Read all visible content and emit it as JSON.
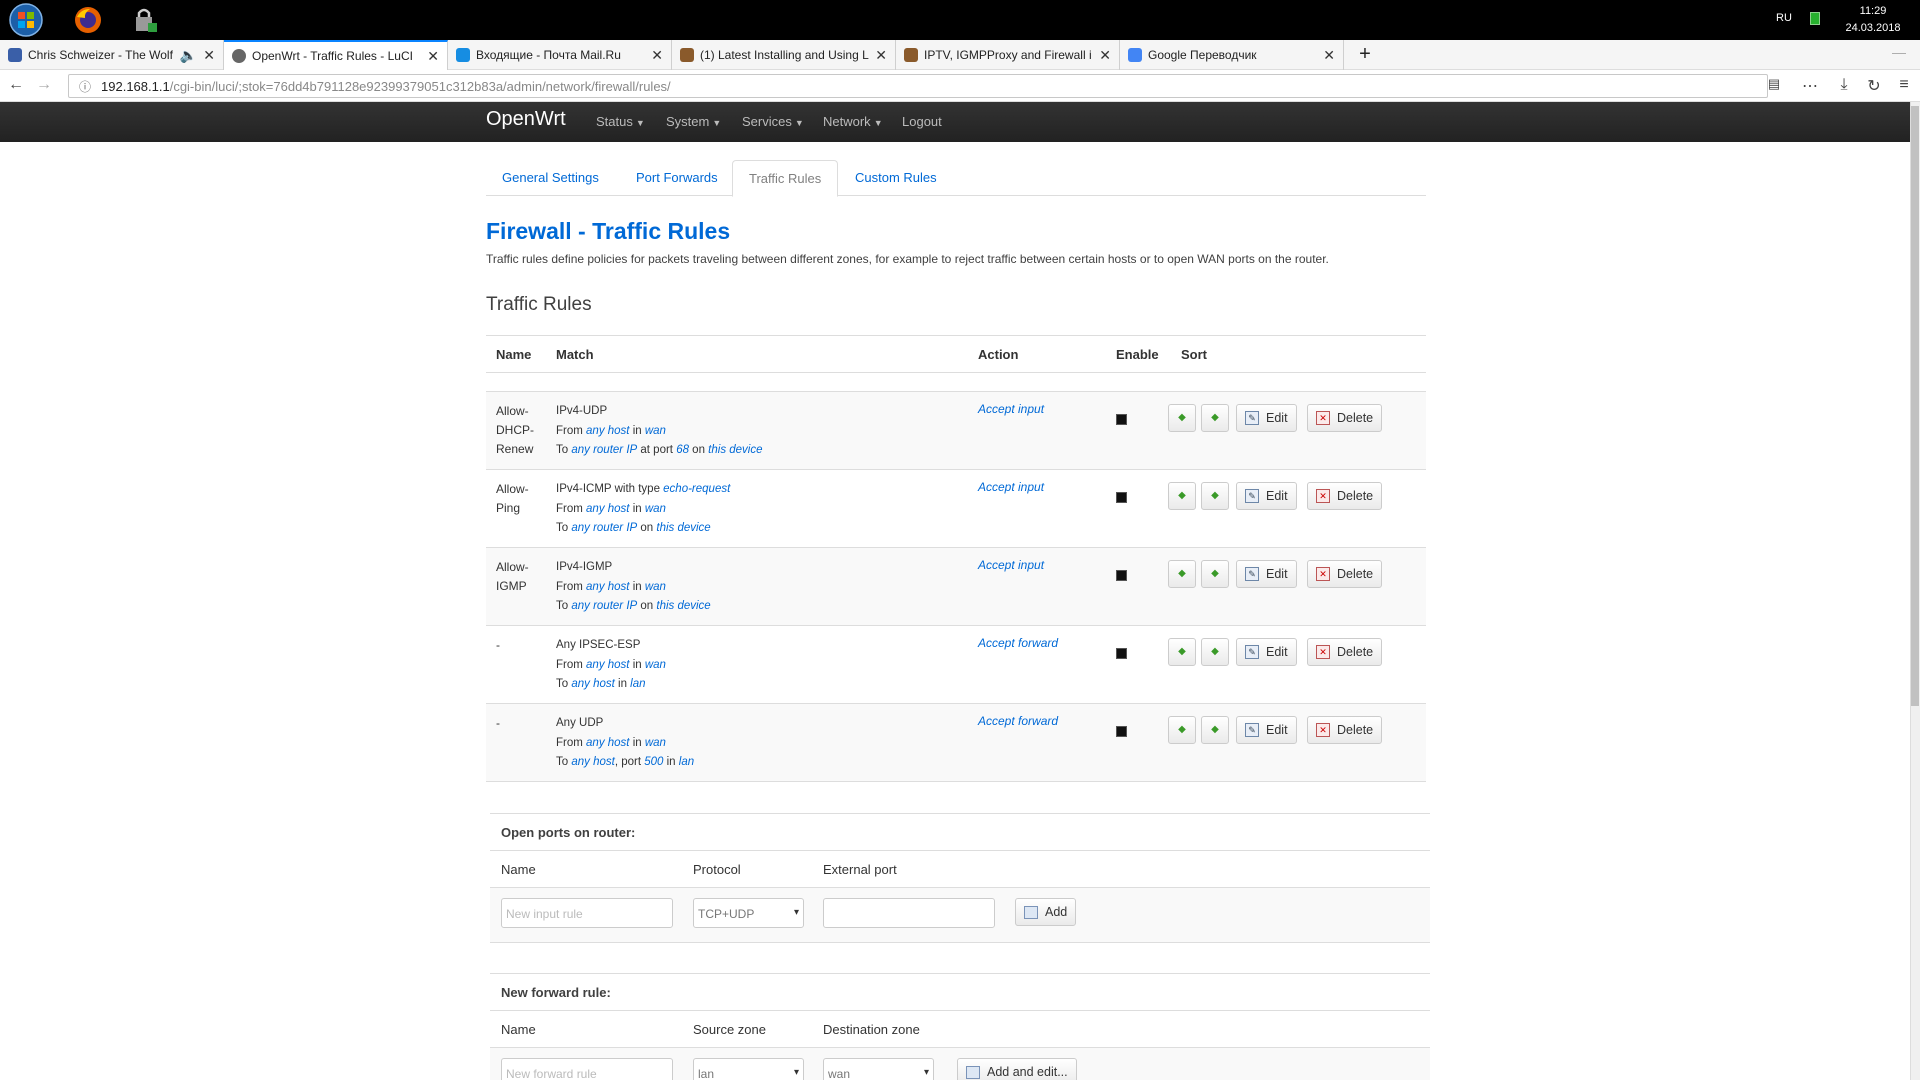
{
  "taskbar": {
    "lang": "RU",
    "time": "11:29",
    "date": "24.03.2018"
  },
  "browser": {
    "tabs": [
      {
        "title": "Chris Schweizer - The Wolf",
        "color": "#3a5fa8"
      },
      {
        "title": "OpenWrt - Traffic Rules - LuCI",
        "color": "#666666"
      },
      {
        "title": "Входящие - Почта Mail.Ru",
        "color": "#168de2"
      },
      {
        "title": "(1) Latest Installing and Using L",
        "color": "#8a5a2b"
      },
      {
        "title": "IPTV, IGMPProxy and Firewall i",
        "color": "#8a5a2b"
      },
      {
        "title": "Google Переводчик",
        "color": "#4285f4"
      }
    ],
    "url_host": "192.168.1.1",
    "url_path": "/cgi-bin/luci/;stok=76dd4b791128e92399379051c312b83a/admin/network/firewall/rules/"
  },
  "header": {
    "brand": "OpenWrt",
    "menu": [
      "Status",
      "System",
      "Services",
      "Network"
    ],
    "logout": "Logout"
  },
  "subtabs": [
    "General Settings",
    "Port Forwards",
    "Traffic Rules",
    "Custom Rules"
  ],
  "page": {
    "title_prefix": "Firewall - ",
    "title_main": "Traffic Rules",
    "description": "Traffic rules define policies for packets traveling between different zones, for example to reject traffic between certain hosts or to open WAN ports on the router.",
    "section_title": "Traffic Rules"
  },
  "table": {
    "headers": {
      "name": "Name",
      "match": "Match",
      "action": "Action",
      "enable": "Enable",
      "sort": "Sort"
    },
    "edit_label": "Edit",
    "delete_label": "Delete",
    "rows": [
      {
        "name": "Allow-DHCP-Renew",
        "match_line1": "IPv4-UDP",
        "from_host": "any host",
        "from_zone": "wan",
        "to_host": "any router IP",
        "to_mid": " at port ",
        "to_port": "68",
        "to_on": " on ",
        "to_zone": "this device",
        "action": "Accept input"
      },
      {
        "name": "Allow-Ping",
        "match_line1_a": "IPv4-ICMP with type ",
        "match_line1_b": "echo-request",
        "from_host": "any host",
        "from_zone": "wan",
        "to_host": "any router IP",
        "to_on": " on ",
        "to_zone": "this device",
        "action": "Accept input"
      },
      {
        "name": "Allow-IGMP",
        "match_line1": "IPv4-IGMP",
        "from_host": "any host",
        "from_zone": "wan",
        "to_host": "any router IP",
        "to_on": " on ",
        "to_zone": "this device",
        "action": "Accept input"
      },
      {
        "name": "-",
        "match_line1": "Any IPSEC-ESP",
        "from_host": "any host",
        "from_zone": "wan",
        "to_host": "any host",
        "to_on": " in ",
        "to_zone": "lan",
        "action": "Accept forward"
      },
      {
        "name": "-",
        "match_line1": "Any UDP",
        "from_host": "any host",
        "from_zone": "wan",
        "to_host": "any host",
        "to_mid": ", port ",
        "to_port": "500",
        "to_on": " in ",
        "to_zone": "lan",
        "action": "Accept forward"
      }
    ]
  },
  "open_ports": {
    "title": "Open ports on router:",
    "col_name": "Name",
    "col_protocol": "Protocol",
    "col_port": "External port",
    "name_placeholder": "New input rule",
    "protocol_value": "TCP+UDP",
    "add_label": "Add"
  },
  "forward_rule": {
    "title": "New forward rule:",
    "col_name": "Name",
    "col_src": "Source zone",
    "col_dst": "Destination zone",
    "name_placeholder": "New forward rule",
    "src_value": "lan",
    "dst_value": "wan",
    "add_label": "Add and edit..."
  },
  "labels": {
    "from": "From ",
    "in": " in ",
    "to": "To "
  }
}
